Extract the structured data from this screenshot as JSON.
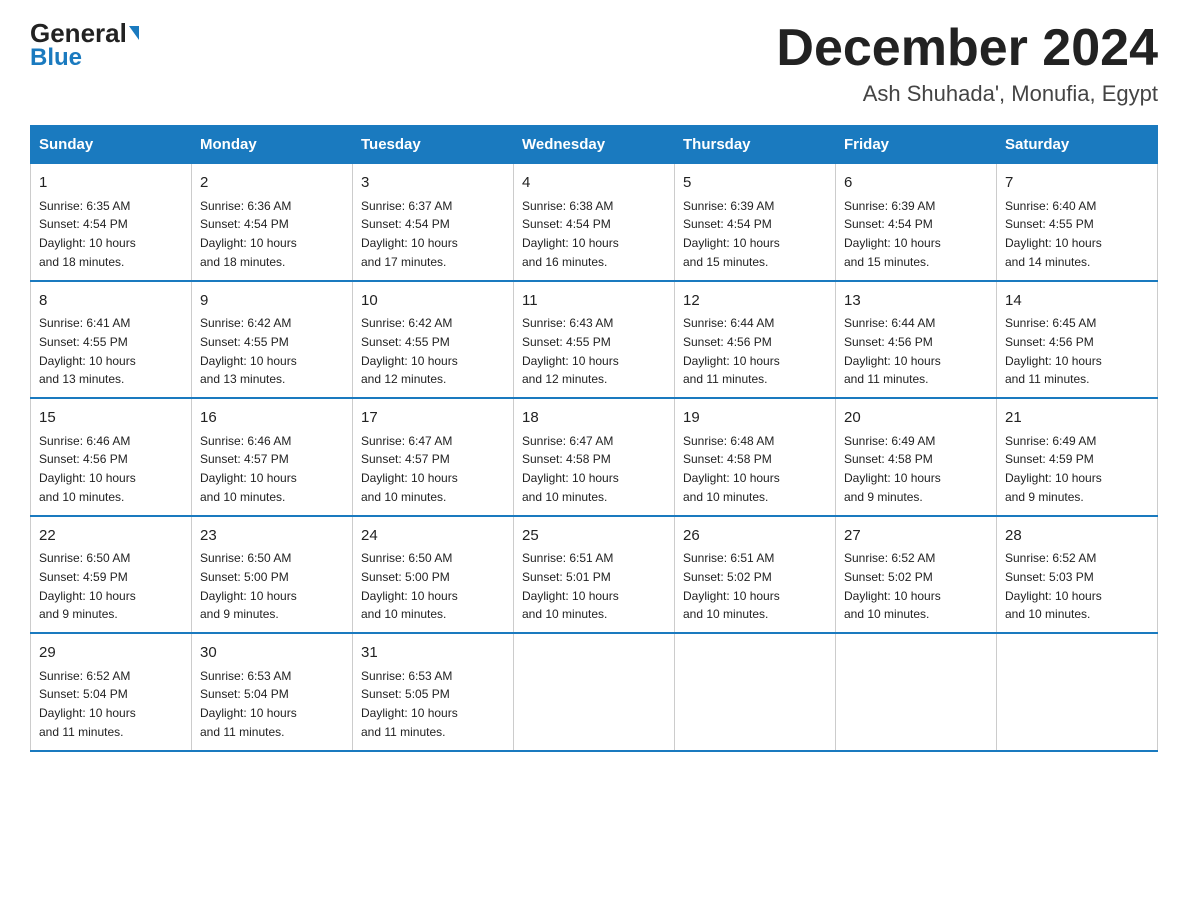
{
  "header": {
    "logo_general": "General",
    "logo_blue": "Blue",
    "month_title": "December 2024",
    "location": "Ash Shuhada', Monufia, Egypt"
  },
  "days_of_week": [
    "Sunday",
    "Monday",
    "Tuesday",
    "Wednesday",
    "Thursday",
    "Friday",
    "Saturday"
  ],
  "weeks": [
    [
      {
        "day": "1",
        "sunrise": "6:35 AM",
        "sunset": "4:54 PM",
        "daylight": "10 hours and 18 minutes."
      },
      {
        "day": "2",
        "sunrise": "6:36 AM",
        "sunset": "4:54 PM",
        "daylight": "10 hours and 18 minutes."
      },
      {
        "day": "3",
        "sunrise": "6:37 AM",
        "sunset": "4:54 PM",
        "daylight": "10 hours and 17 minutes."
      },
      {
        "day": "4",
        "sunrise": "6:38 AM",
        "sunset": "4:54 PM",
        "daylight": "10 hours and 16 minutes."
      },
      {
        "day": "5",
        "sunrise": "6:39 AM",
        "sunset": "4:54 PM",
        "daylight": "10 hours and 15 minutes."
      },
      {
        "day": "6",
        "sunrise": "6:39 AM",
        "sunset": "4:54 PM",
        "daylight": "10 hours and 15 minutes."
      },
      {
        "day": "7",
        "sunrise": "6:40 AM",
        "sunset": "4:55 PM",
        "daylight": "10 hours and 14 minutes."
      }
    ],
    [
      {
        "day": "8",
        "sunrise": "6:41 AM",
        "sunset": "4:55 PM",
        "daylight": "10 hours and 13 minutes."
      },
      {
        "day": "9",
        "sunrise": "6:42 AM",
        "sunset": "4:55 PM",
        "daylight": "10 hours and 13 minutes."
      },
      {
        "day": "10",
        "sunrise": "6:42 AM",
        "sunset": "4:55 PM",
        "daylight": "10 hours and 12 minutes."
      },
      {
        "day": "11",
        "sunrise": "6:43 AM",
        "sunset": "4:55 PM",
        "daylight": "10 hours and 12 minutes."
      },
      {
        "day": "12",
        "sunrise": "6:44 AM",
        "sunset": "4:56 PM",
        "daylight": "10 hours and 11 minutes."
      },
      {
        "day": "13",
        "sunrise": "6:44 AM",
        "sunset": "4:56 PM",
        "daylight": "10 hours and 11 minutes."
      },
      {
        "day": "14",
        "sunrise": "6:45 AM",
        "sunset": "4:56 PM",
        "daylight": "10 hours and 11 minutes."
      }
    ],
    [
      {
        "day": "15",
        "sunrise": "6:46 AM",
        "sunset": "4:56 PM",
        "daylight": "10 hours and 10 minutes."
      },
      {
        "day": "16",
        "sunrise": "6:46 AM",
        "sunset": "4:57 PM",
        "daylight": "10 hours and 10 minutes."
      },
      {
        "day": "17",
        "sunrise": "6:47 AM",
        "sunset": "4:57 PM",
        "daylight": "10 hours and 10 minutes."
      },
      {
        "day": "18",
        "sunrise": "6:47 AM",
        "sunset": "4:58 PM",
        "daylight": "10 hours and 10 minutes."
      },
      {
        "day": "19",
        "sunrise": "6:48 AM",
        "sunset": "4:58 PM",
        "daylight": "10 hours and 10 minutes."
      },
      {
        "day": "20",
        "sunrise": "6:49 AM",
        "sunset": "4:58 PM",
        "daylight": "10 hours and 9 minutes."
      },
      {
        "day": "21",
        "sunrise": "6:49 AM",
        "sunset": "4:59 PM",
        "daylight": "10 hours and 9 minutes."
      }
    ],
    [
      {
        "day": "22",
        "sunrise": "6:50 AM",
        "sunset": "4:59 PM",
        "daylight": "10 hours and 9 minutes."
      },
      {
        "day": "23",
        "sunrise": "6:50 AM",
        "sunset": "5:00 PM",
        "daylight": "10 hours and 9 minutes."
      },
      {
        "day": "24",
        "sunrise": "6:50 AM",
        "sunset": "5:00 PM",
        "daylight": "10 hours and 10 minutes."
      },
      {
        "day": "25",
        "sunrise": "6:51 AM",
        "sunset": "5:01 PM",
        "daylight": "10 hours and 10 minutes."
      },
      {
        "day": "26",
        "sunrise": "6:51 AM",
        "sunset": "5:02 PM",
        "daylight": "10 hours and 10 minutes."
      },
      {
        "day": "27",
        "sunrise": "6:52 AM",
        "sunset": "5:02 PM",
        "daylight": "10 hours and 10 minutes."
      },
      {
        "day": "28",
        "sunrise": "6:52 AM",
        "sunset": "5:03 PM",
        "daylight": "10 hours and 10 minutes."
      }
    ],
    [
      {
        "day": "29",
        "sunrise": "6:52 AM",
        "sunset": "5:04 PM",
        "daylight": "10 hours and 11 minutes."
      },
      {
        "day": "30",
        "sunrise": "6:53 AM",
        "sunset": "5:04 PM",
        "daylight": "10 hours and 11 minutes."
      },
      {
        "day": "31",
        "sunrise": "6:53 AM",
        "sunset": "5:05 PM",
        "daylight": "10 hours and 11 minutes."
      },
      null,
      null,
      null,
      null
    ]
  ],
  "labels": {
    "sunrise": "Sunrise:",
    "sunset": "Sunset:",
    "daylight": "Daylight:"
  }
}
